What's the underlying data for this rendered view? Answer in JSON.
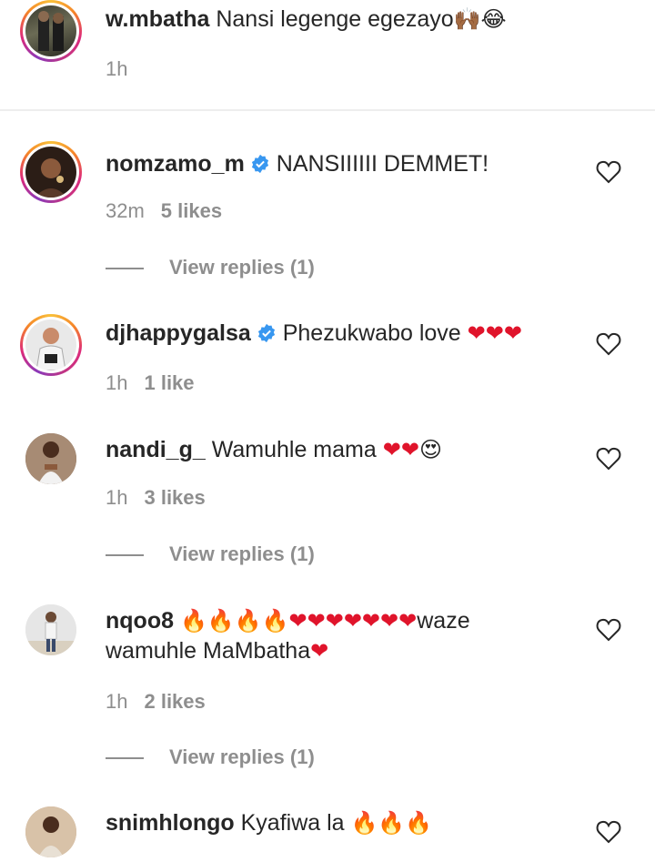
{
  "comments": [
    {
      "username": "w.mbatha",
      "text": "Nansi legenge egezayo",
      "emoji": "🙌🏾😂",
      "time": "1h",
      "likes": "",
      "verified": false
    },
    {
      "username": "nomzamo_m",
      "text": "NANSIIIIII DEMMET!",
      "time": "32m",
      "likes": "5 likes",
      "replies": "View replies (1)",
      "verified": true
    },
    {
      "username": "djhappygalsa",
      "text": "Phezukwabo love",
      "emoji": "❤❤❤",
      "time": "1h",
      "likes": "1 like",
      "verified": true
    },
    {
      "username": "nandi_g_",
      "text": "Wamuhle mama",
      "emoji_hearts": "❤❤",
      "emoji_face": "😍",
      "time": "1h",
      "likes": "3 likes",
      "replies": "View replies (1)",
      "verified": false
    },
    {
      "username": "nqoo8",
      "emoji_fire": "🔥🔥🔥🔥",
      "emoji_hearts": "❤❤❤❤❤❤❤",
      "text_line1": "waze",
      "text_line2": "wamuhle MaMbatha",
      "emoji_end": "❤",
      "time": "1h",
      "likes": "2 likes",
      "replies": "View replies (1)",
      "verified": false
    },
    {
      "username": "snimhlongo",
      "text": "Kyafiwa la",
      "emoji_fire": "🔥🔥🔥",
      "verified": false
    }
  ],
  "icons": {
    "heart_outline": "heart-outline-icon",
    "verified": "verified-badge-icon"
  },
  "colors": {
    "verified_blue": "#3897f0",
    "secondary_text": "#8e8e8e",
    "heart_red": "#e0142b"
  }
}
